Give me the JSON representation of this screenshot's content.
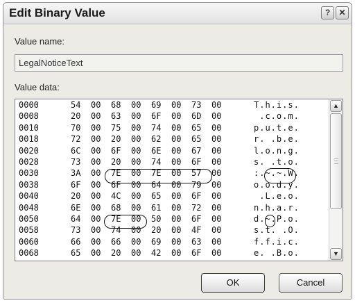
{
  "dialog": {
    "title": "Edit Binary Value",
    "help_glyph": "?",
    "close_glyph": "✕"
  },
  "value_name": {
    "label": "Value name:",
    "value": "LegalNoticeText"
  },
  "value_data": {
    "label": "Value data:",
    "rows": [
      {
        "offset": "0000",
        "bytes": [
          "54",
          "00",
          "68",
          "00",
          "69",
          "00",
          "73",
          "00"
        ],
        "ascii": "T.h.i.s."
      },
      {
        "offset": "0008",
        "bytes": [
          "20",
          "00",
          "63",
          "00",
          "6F",
          "00",
          "6D",
          "00"
        ],
        "ascii": " .c.o.m."
      },
      {
        "offset": "0010",
        "bytes": [
          "70",
          "00",
          "75",
          "00",
          "74",
          "00",
          "65",
          "00"
        ],
        "ascii": "p.u.t.e."
      },
      {
        "offset": "0018",
        "bytes": [
          "72",
          "00",
          "20",
          "00",
          "62",
          "00",
          "65",
          "00"
        ],
        "ascii": "r. .b.e."
      },
      {
        "offset": "0020",
        "bytes": [
          "6C",
          "00",
          "6F",
          "00",
          "6E",
          "00",
          "67",
          "00"
        ],
        "ascii": "l.o.n.g."
      },
      {
        "offset": "0028",
        "bytes": [
          "73",
          "00",
          "20",
          "00",
          "74",
          "00",
          "6F",
          "00"
        ],
        "ascii": "s. .t.o."
      },
      {
        "offset": "0030",
        "bytes": [
          "3A",
          "00",
          "7E",
          "00",
          "7E",
          "00",
          "57",
          "00"
        ],
        "ascii": ":.~.~.W."
      },
      {
        "offset": "0038",
        "bytes": [
          "6F",
          "00",
          "6F",
          "00",
          "64",
          "00",
          "79",
          "00"
        ],
        "ascii": "o.o.d.y."
      },
      {
        "offset": "0040",
        "bytes": [
          "20",
          "00",
          "4C",
          "00",
          "65",
          "00",
          "6F",
          "00"
        ],
        "ascii": " .L.e.o."
      },
      {
        "offset": "0048",
        "bytes": [
          "6E",
          "00",
          "68",
          "00",
          "61",
          "00",
          "72",
          "00"
        ],
        "ascii": "n.h.a.r."
      },
      {
        "offset": "0050",
        "bytes": [
          "64",
          "00",
          "7E",
          "00",
          "50",
          "00",
          "6F",
          "00"
        ],
        "ascii": "d.~.P.o."
      },
      {
        "offset": "0058",
        "bytes": [
          "73",
          "00",
          "74",
          "00",
          "20",
          "00",
          "4F",
          "00"
        ],
        "ascii": "s.t. .O."
      },
      {
        "offset": "0060",
        "bytes": [
          "66",
          "00",
          "66",
          "00",
          "69",
          "00",
          "63",
          "00"
        ],
        "ascii": "f.f.i.c."
      },
      {
        "offset": "0068",
        "bytes": [
          "65",
          "00",
          "20",
          "00",
          "42",
          "00",
          "6F",
          "00"
        ],
        "ascii": "e. .B.o."
      }
    ],
    "scroll_up_glyph": "▲",
    "scroll_down_glyph": "▼"
  },
  "buttons": {
    "ok": "OK",
    "cancel": "Cancel"
  }
}
